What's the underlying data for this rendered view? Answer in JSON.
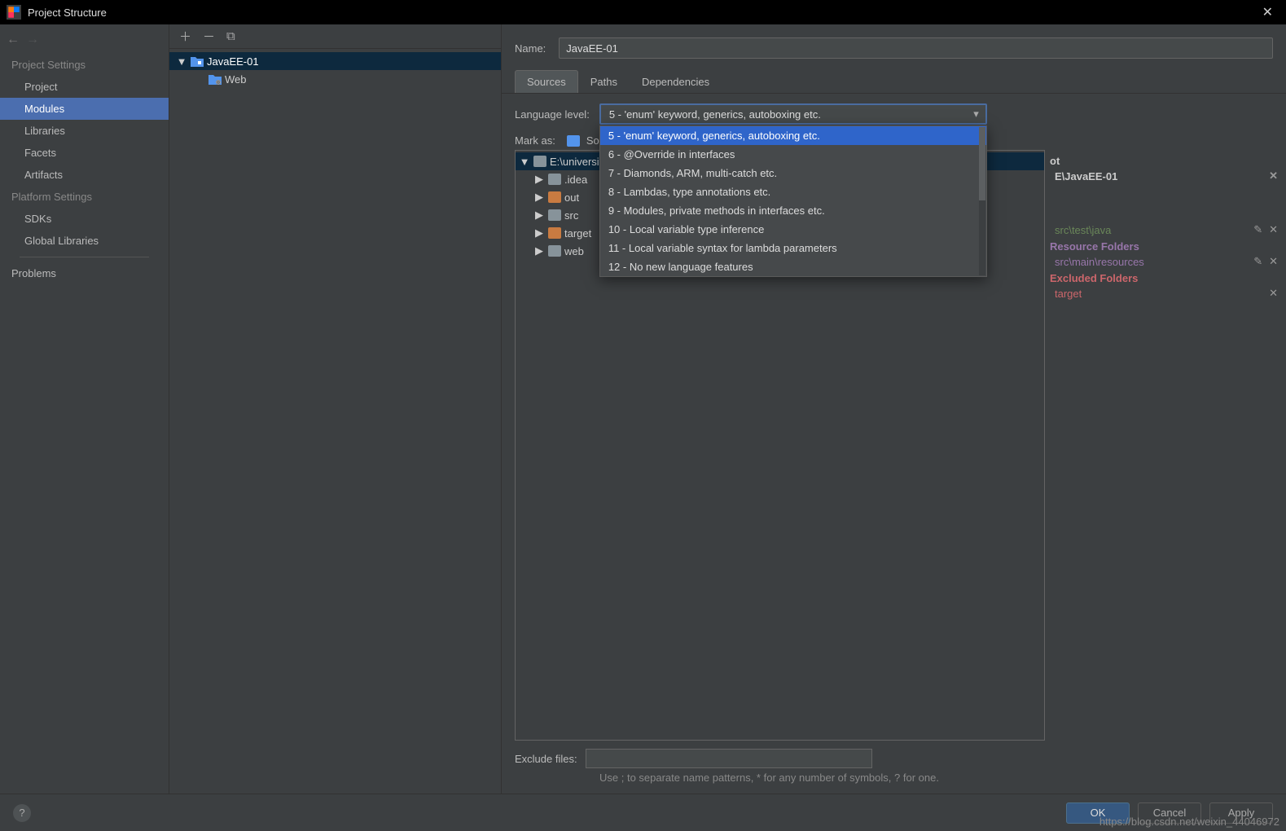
{
  "window": {
    "title": "Project Structure"
  },
  "leftnav": {
    "project_settings_head": "Project Settings",
    "platform_settings_head": "Platform Settings",
    "items": {
      "project": "Project",
      "modules": "Modules",
      "libraries": "Libraries",
      "facets": "Facets",
      "artifacts": "Artifacts",
      "sdks": "SDKs",
      "global_libraries": "Global Libraries",
      "problems": "Problems"
    }
  },
  "module_tree": {
    "root": "JavaEE-01",
    "child": "Web"
  },
  "right": {
    "name_label": "Name:",
    "name_value": "JavaEE-01",
    "tabs": {
      "sources": "Sources",
      "paths": "Paths",
      "deps": "Dependencies"
    },
    "lang_label": "Language level:",
    "lang_selected": "5 - 'enum' keyword, generics, autoboxing etc.",
    "lang_options": [
      "5 - 'enum' keyword, generics, autoboxing etc.",
      "6 - @Override in interfaces",
      "7 - Diamonds, ARM, multi-catch etc.",
      "8 - Lambdas, type annotations etc.",
      "9 - Modules, private methods in interfaces etc.",
      "10 - Local variable type inference",
      "11 - Local variable syntax for lambda parameters",
      "12 - No new language features"
    ],
    "mark_as": "Mark as:",
    "mark_sources": "Sources",
    "src_tree": {
      "root": "E:\\university\\JavaEE\\JavaEE-01",
      "children": [
        ".idea",
        "out",
        "src",
        "target",
        "web"
      ]
    },
    "side": {
      "root_head_suffix": "ot",
      "root_path": "E\\JavaEE-01",
      "test_path": "src\\test\\java",
      "resource_head": "Resource Folders",
      "resource_path": "src\\main\\resources",
      "excluded_head": "Excluded Folders",
      "excluded_path": "target"
    },
    "exclude_label": "Exclude files:",
    "exclude_hint_1": "Use ; to separate name patterns, * for any number of symbols, ? for one."
  },
  "footer": {
    "ok": "OK",
    "cancel": "Cancel",
    "apply": "Apply"
  },
  "watermark": "https://blog.csdn.net/weixin_44046972"
}
